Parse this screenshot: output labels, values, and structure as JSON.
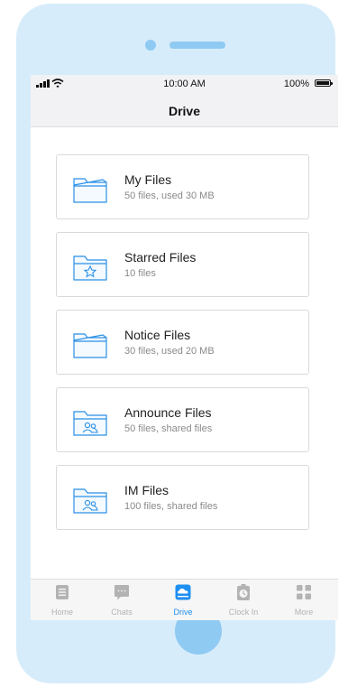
{
  "status_bar": {
    "time": "10:00 AM",
    "battery": "100%"
  },
  "nav": {
    "title": "Drive"
  },
  "files": [
    {
      "title": "My Files",
      "subtitle": "50 files, used 30 MB",
      "icon": "folder-open-icon"
    },
    {
      "title": "Starred Files",
      "subtitle": "10 files",
      "icon": "folder-star-icon"
    },
    {
      "title": "Notice Files",
      "subtitle": "30 files, used 20 MB",
      "icon": "folder-open-icon"
    },
    {
      "title": "Announce Files",
      "subtitle": "50 files, shared files",
      "icon": "folder-shared-icon"
    },
    {
      "title": "IM Files",
      "subtitle": "100 files, shared files",
      "icon": "folder-shared-icon"
    }
  ],
  "tabs": [
    {
      "label": "Home",
      "icon": "home-icon",
      "active": false
    },
    {
      "label": "Chats",
      "icon": "chat-icon",
      "active": false
    },
    {
      "label": "Drive",
      "icon": "cloud-drive-icon",
      "active": true
    },
    {
      "label": "Clock In",
      "icon": "clock-in-icon",
      "active": false
    },
    {
      "label": "More",
      "icon": "grid-icon",
      "active": false
    }
  ],
  "colors": {
    "accent": "#1f8ff0",
    "phone_frame": "#d7ecfa",
    "phone_details": "#8fcaf3",
    "inactive": "#b3b3b3"
  }
}
